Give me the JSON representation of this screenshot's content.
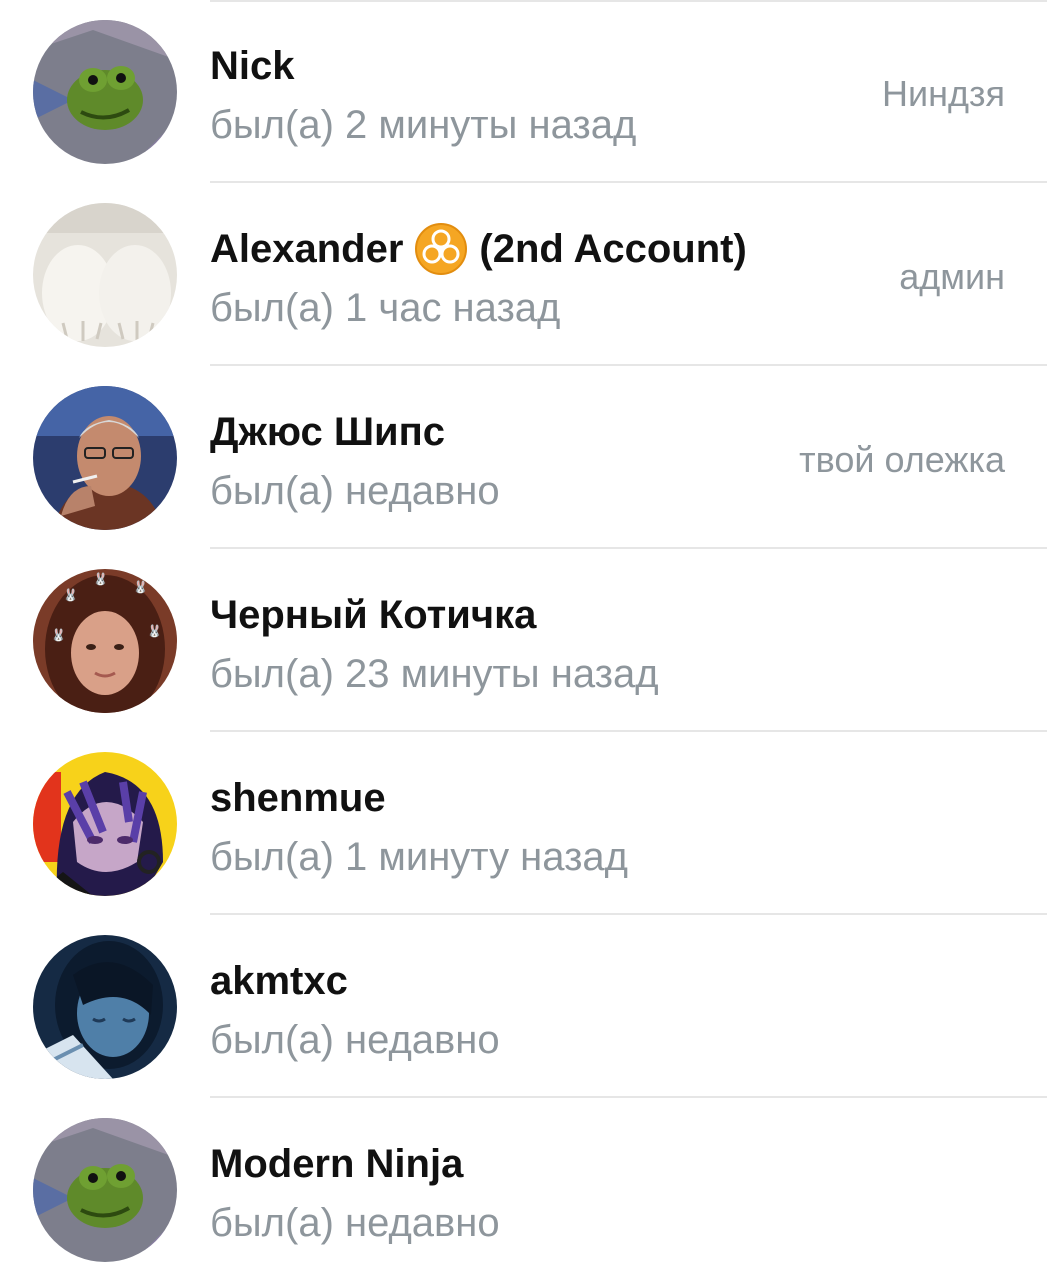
{
  "members": [
    {
      "name": "Nick",
      "status": "был(а) 2 минуты назад",
      "role": "Ниндзя",
      "avatar": "kermit-avatar"
    },
    {
      "name": "Alexander",
      "name_badge": "biohazard-emoji",
      "name_suffix": "(2nd Account)",
      "status": "был(а) 1 час назад",
      "role": "админ",
      "avatar": "fluffy-paws-avatar"
    },
    {
      "name": "Джюс Шипс",
      "status": "был(а) недавно",
      "role": "твой олежка",
      "avatar": "old-man-smoking-avatar"
    },
    {
      "name": "Черный Котичка",
      "status": "был(а) 23 минуты назад",
      "role": "",
      "avatar": "girl-selfie-avatar"
    },
    {
      "name": "shenmue",
      "status": "был(а) 1 минуту назад",
      "role": "",
      "avatar": "anime-character-avatar"
    },
    {
      "name": "akmtxc",
      "status": "был(а) недавно",
      "role": "",
      "avatar": "anime-girl-blue-avatar"
    },
    {
      "name": "Modern Ninja",
      "status": "был(а) недавно",
      "role": "",
      "avatar": "kermit-avatar"
    }
  ],
  "colors": {
    "name_text": "#111111",
    "secondary_text": "#8e969c",
    "divider": "#e6e6e6",
    "background": "#ffffff"
  }
}
